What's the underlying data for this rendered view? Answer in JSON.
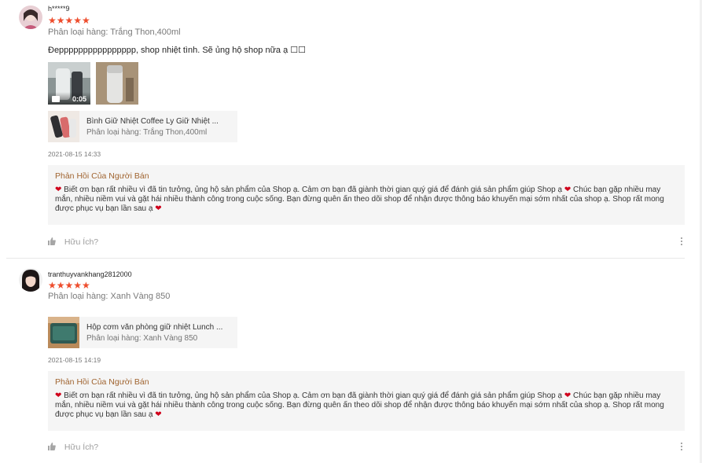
{
  "reviews": [
    {
      "username": "h*****9",
      "stars": "★★★★★",
      "variation": "Phân loại hàng: Trắng Thon,400ml",
      "comment": "Đepppppppppppppppp, shop nhiệt tình. Sẽ ủng hộ shop nữa ạ ☐☐",
      "video_duration": "0:05",
      "product_name": "Bình Giữ Nhiệt Coffee Ly Giữ Nhiệt ...",
      "product_variation": "Phân loại hàng: Trắng Thon,400ml",
      "timestamp": "2021-08-15 14:33",
      "reply_title": "Phản Hồi Của Người Bán",
      "reply_text": "Biết ơn bạn rất nhiều vì đã tin tưởng, ủng hộ sản phẩm của Shop ạ. Cảm ơn bạn đã giành thời gian quý giá để đánh giá sản phẩm giúp Shop ạ",
      "reply_text_2": "Chúc bạn gặp nhiều may mắn, nhiều niềm vui và gặt hái nhiều thành công trong cuộc sống. Bạn đừng quên ấn theo dõi shop để nhận được thông báo khuyến mại sớm nhất của shop ạ. Shop rất mong được phục vụ bạn lần sau ạ",
      "helpful": "Hữu Ích?"
    },
    {
      "username": "tranthuyvankhang2812000",
      "stars": "★★★★★",
      "variation": "Phân loại hàng: Xanh Vàng 850",
      "product_name": "Hộp cơm văn phòng giữ nhiệt Lunch ...",
      "product_variation": "Phân loại hàng: Xanh Vàng 850",
      "timestamp": "2021-08-15 14:19",
      "reply_title": "Phản Hồi Của Người Bán",
      "reply_text": "Biết ơn bạn rất nhiều vì đã tin tưởng, ủng hộ sản phẩm của Shop ạ. Cảm ơn bạn đã giành thời gian quý giá để đánh giá sản phẩm giúp Shop ạ",
      "reply_text_2": "Chúc bạn gặp nhiều may mắn, nhiều niềm vui và gặt hái nhiều thành công trong cuộc sống. Bạn đừng quên ấn theo dõi shop để nhận được thông báo khuyến mại sớm nhất của shop ạ. Shop rất mong được phục vụ bạn lần sau ạ",
      "helpful": "Hữu Ích?"
    }
  ],
  "icons": {
    "heart": "heart-icon",
    "thumb": "thumbs-up-icon",
    "more": "more-vertical-icon",
    "video": "video-camera-icon"
  },
  "colors": {
    "stars": "#ee4d2d",
    "reply_title": "#a06430",
    "heart": "#d0011b"
  }
}
